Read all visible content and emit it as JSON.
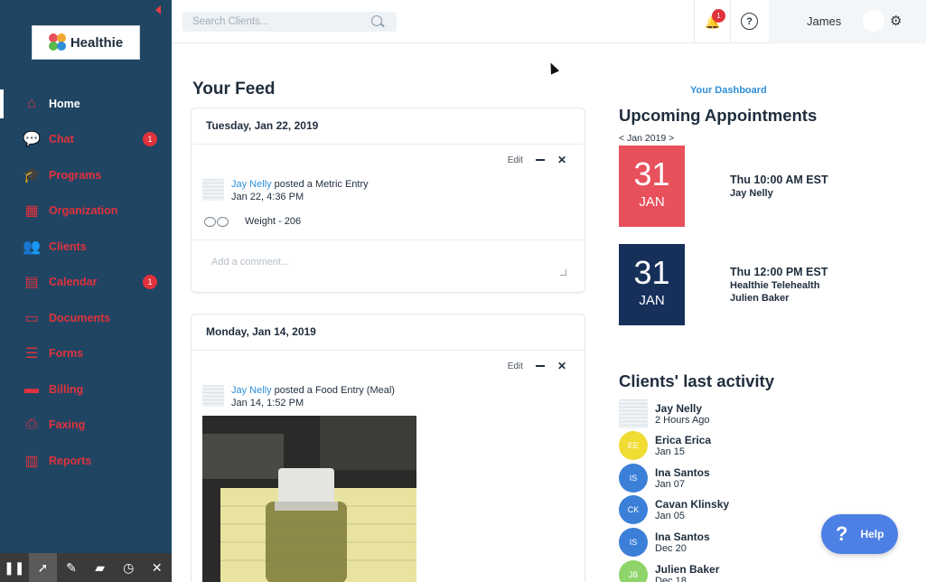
{
  "sidebar": {
    "brand": "Healthie",
    "items": [
      {
        "label": "Home",
        "icon": "home-icon",
        "active": true,
        "badge": ""
      },
      {
        "label": "Chat",
        "icon": "chat-icon",
        "active": false,
        "badge": "1"
      },
      {
        "label": "Programs",
        "icon": "graduation-cap-icon",
        "active": false,
        "badge": ""
      },
      {
        "label": "Organization",
        "icon": "building-icon",
        "active": false,
        "badge": ""
      },
      {
        "label": "Clients",
        "icon": "users-icon",
        "active": false,
        "badge": ""
      },
      {
        "label": "Calendar",
        "icon": "calendar-icon",
        "active": false,
        "badge": "1"
      },
      {
        "label": "Documents",
        "icon": "folder-icon",
        "active": false,
        "badge": ""
      },
      {
        "label": "Forms",
        "icon": "clipboard-icon",
        "active": false,
        "badge": ""
      },
      {
        "label": "Billing",
        "icon": "credit-card-icon",
        "active": false,
        "badge": ""
      },
      {
        "label": "Faxing",
        "icon": "fax-icon",
        "active": false,
        "badge": ""
      },
      {
        "label": "Reports",
        "icon": "report-icon",
        "active": false,
        "badge": ""
      }
    ]
  },
  "toolbar": {
    "buttons": [
      "pause-icon",
      "pointer-icon",
      "pen-icon",
      "eraser-icon",
      "timer-icon",
      "close-icon"
    ]
  },
  "topbar": {
    "search_placeholder": "Search Clients...",
    "notification_count": "1",
    "help_label": "?",
    "user_name": "James"
  },
  "feed": {
    "title": "Your Feed",
    "edit_label": "Edit",
    "cards": [
      {
        "date": "Tuesday, Jan 22, 2019",
        "author": "Jay Nelly",
        "action": " posted a Metric Entry",
        "time": "Jan 22, 4:36 PM",
        "metric": "Weight - 206",
        "comment_placeholder": "Add a comment..."
      },
      {
        "date": "Monday, Jan 14, 2019",
        "author": "Jay Nelly",
        "action": " posted a Food Entry (Meal)",
        "time": "Jan 14, 1:52 PM"
      }
    ]
  },
  "dashboard": {
    "link": "Your Dashboard",
    "appointments_title": "Upcoming Appointments",
    "month_nav": "< Jan 2019 >",
    "appointments": [
      {
        "day": "31",
        "month": "JAN",
        "color": "#e8505b",
        "time": "Thu 10:00 AM EST",
        "lines": [
          "Jay Nelly"
        ]
      },
      {
        "day": "31",
        "month": "JAN",
        "color": "#16305a",
        "time": "Thu 12:00 PM EST",
        "lines": [
          "Healthie Telehealth",
          "Julien Baker"
        ]
      }
    ],
    "activity_title": "Clients' last activity",
    "activity": [
      {
        "name": "Jay Nelly",
        "date": "2 Hours Ago",
        "initials": "",
        "color": "#ffffff"
      },
      {
        "name": "Erica Erica",
        "date": "Jan 15",
        "initials": "EE",
        "color": "#f0dc33"
      },
      {
        "name": "Ina Santos",
        "date": "Jan 07",
        "initials": "IS",
        "color": "#3c7fd8"
      },
      {
        "name": "Cavan Klinsky",
        "date": "Jan 05",
        "initials": "CK",
        "color": "#3c7fd8"
      },
      {
        "name": "Ina Santos",
        "date": "Dec 20",
        "initials": "IS",
        "color": "#3c7fd8"
      },
      {
        "name": "Julien Baker",
        "date": "Dec 18",
        "initials": "JB",
        "color": "#8fd46a"
      }
    ]
  },
  "help_widget": {
    "label": "Help",
    "glyph": "?"
  },
  "colors": {
    "sidebar": "#1f4563",
    "accent": "#e0323c",
    "link": "#2f8fd8"
  }
}
